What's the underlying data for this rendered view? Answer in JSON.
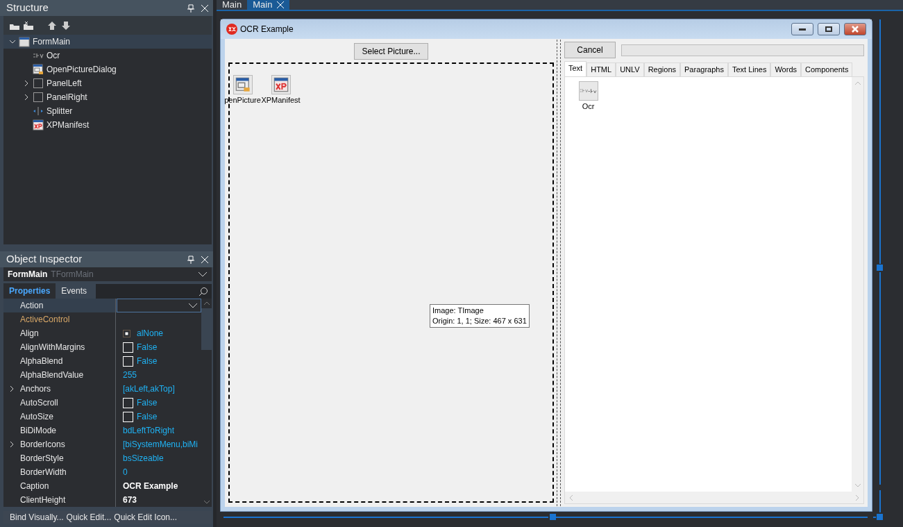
{
  "structure": {
    "title": "Structure",
    "tree": [
      {
        "label": "FormMain",
        "kind": "form",
        "selected": true,
        "expanded": true,
        "children": [
          {
            "label": "Ocr",
            "kind": "ocr",
            "selected": false
          },
          {
            "label": "OpenPictureDialog",
            "kind": "dialog",
            "selected": false
          },
          {
            "label": "PanelLeft",
            "kind": "panel",
            "selected": false,
            "expanded": false
          },
          {
            "label": "PanelRight",
            "kind": "panel",
            "selected": false,
            "expanded": false
          },
          {
            "label": "Splitter",
            "kind": "splitter",
            "selected": false
          },
          {
            "label": "XPManifest",
            "kind": "xp",
            "selected": false
          }
        ]
      }
    ]
  },
  "inspector": {
    "title": "Object Inspector",
    "object": "FormMain",
    "class": "TFormMain",
    "tabs": [
      {
        "label": "Properties",
        "selected": true
      },
      {
        "label": "Events",
        "selected": false
      }
    ],
    "properties": [
      {
        "name": "Action",
        "kind": "dropdown",
        "selected": true
      },
      {
        "name": "ActiveControl",
        "kind": "reference",
        "selected": false
      },
      {
        "name": "Align",
        "kind": "align",
        "value": "alNone",
        "selected": false
      },
      {
        "name": "AlignWithMargins",
        "kind": "checkbox",
        "value": "False",
        "checked": false,
        "selected": false
      },
      {
        "name": "AlphaBlend",
        "kind": "checkbox",
        "value": "False",
        "checked": false,
        "selected": false
      },
      {
        "name": "AlphaBlendValue",
        "kind": "text",
        "value": "255",
        "selected": false
      },
      {
        "name": "Anchors",
        "kind": "text",
        "value": "[akLeft,akTop]",
        "expanded": false,
        "selected": false
      },
      {
        "name": "AutoScroll",
        "kind": "checkbox",
        "value": "False",
        "checked": false,
        "selected": false
      },
      {
        "name": "AutoSize",
        "kind": "checkbox",
        "value": "False",
        "checked": false,
        "selected": false
      },
      {
        "name": "BiDiMode",
        "kind": "text",
        "value": "bdLeftToRight",
        "selected": false
      },
      {
        "name": "BorderIcons",
        "kind": "text",
        "value": "[biSystemMenu,biMi",
        "expanded": false,
        "selected": false
      },
      {
        "name": "BorderStyle",
        "kind": "text",
        "value": "bsSizeable",
        "selected": false
      },
      {
        "name": "BorderWidth",
        "kind": "text",
        "value": "0",
        "selected": false
      },
      {
        "name": "Caption",
        "kind": "stored",
        "value": "OCR Example",
        "selected": false
      },
      {
        "name": "ClientHeight",
        "kind": "stored",
        "value": "673",
        "selected": false
      }
    ],
    "actions": [
      "Bind Visually...",
      "Quick Edit...",
      "Quick Edit Icon..."
    ]
  },
  "designer": {
    "tabs": [
      {
        "label": "Main",
        "selected": false
      },
      {
        "label": "Main",
        "selected": true
      }
    ],
    "form": {
      "title": "OCR Example",
      "select_button": "Select Picture...",
      "components": [
        {
          "label": "penPicture",
          "kind": "dialog"
        },
        {
          "label": "XPManifest",
          "kind": "xp"
        }
      ],
      "tooltip": [
        "Image: TImage",
        "Origin: 1, 1; Size: 467 x 631"
      ],
      "cancel_button": "Cancel",
      "progress": {
        "level": 0
      },
      "tabs": [
        {
          "label": "Text",
          "selected": true
        },
        {
          "label": "HTML",
          "selected": false
        },
        {
          "label": "UNLV",
          "selected": false
        },
        {
          "label": "Regions",
          "selected": false
        },
        {
          "label": "Paragraphs",
          "selected": false
        },
        {
          "label": "Text Lines",
          "selected": false
        },
        {
          "label": "Words",
          "selected": false
        },
        {
          "label": "Components",
          "selected": false
        }
      ],
      "tab_components": [
        {
          "label": "Ocr",
          "kind": "ocr"
        }
      ]
    }
  }
}
